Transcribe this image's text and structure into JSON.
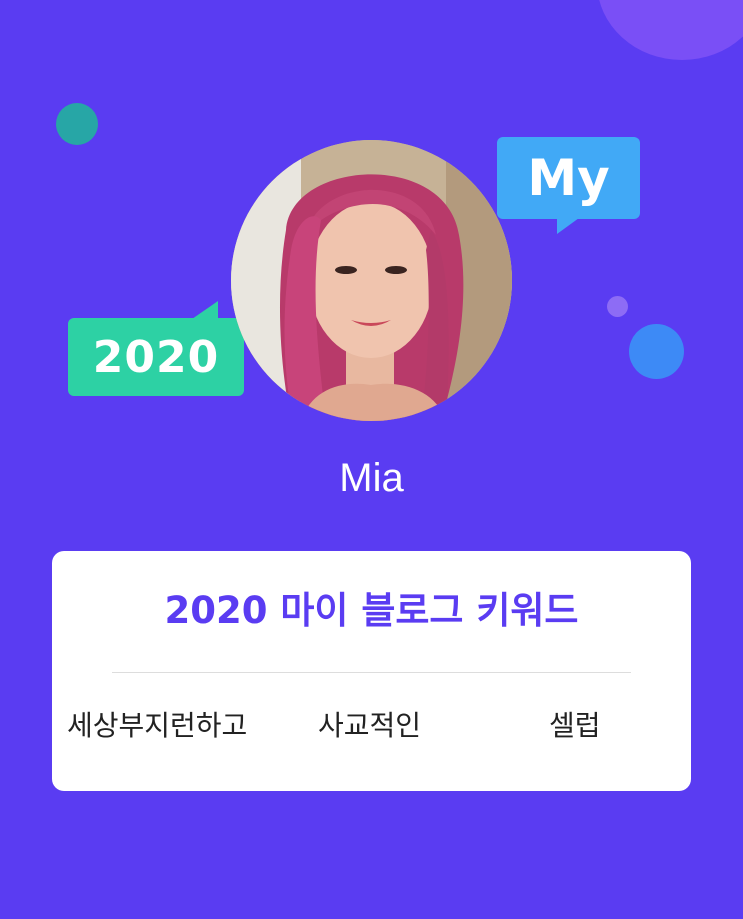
{
  "profile": {
    "name": "Mia"
  },
  "badges": {
    "year": "2020",
    "my": "My"
  },
  "keyword_card": {
    "title": "2020 마이 블로그 키워드",
    "keywords": [
      "세상부지런하고",
      "사교적인",
      "셀럽"
    ]
  },
  "colors": {
    "background": "#5a3cf2",
    "accent": "#5a3cf2",
    "year_badge": "#2dd1a4",
    "my_badge": "#41a9f6",
    "card": "#ffffff"
  }
}
